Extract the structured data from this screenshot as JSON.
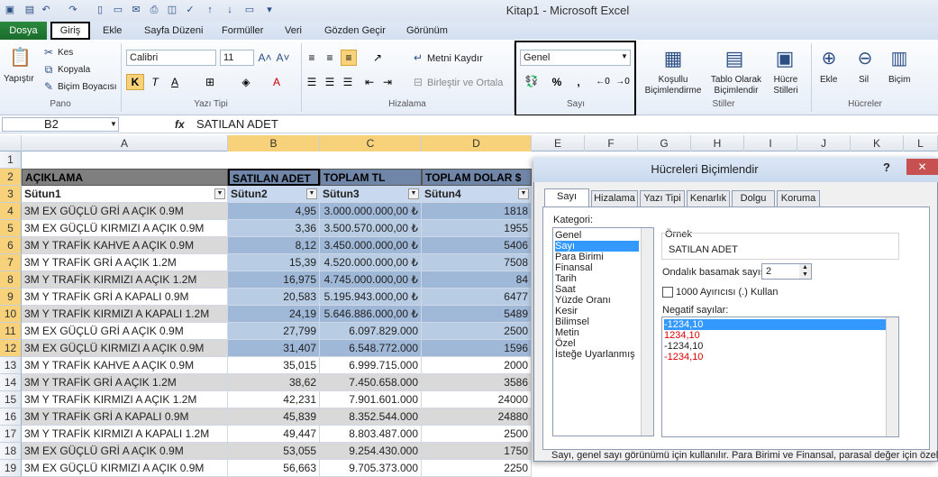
{
  "window": {
    "title": "Kitap1  -  Microsoft Excel"
  },
  "ribbon_tabs": [
    "Dosya",
    "Giriş",
    "Ekle",
    "Sayfa Düzeni",
    "Formüller",
    "Veri",
    "Gözden Geçir",
    "Görünüm"
  ],
  "clipboard": {
    "paste": "Yapıştır",
    "cut": "Kes",
    "copy": "Kopyala",
    "format_painter": "Biçim Boyacısı",
    "group": "Pano"
  },
  "font": {
    "name": "Calibri",
    "size": "11",
    "group": "Yazı Tipi",
    "bold": "K",
    "italic": "T",
    "underline": "A"
  },
  "alignment": {
    "wrap": "Metni Kaydır",
    "merge": "Birleştir ve Ortala",
    "group": "Hizalama"
  },
  "number": {
    "format": "Genel",
    "percent": "%",
    "comma": ",",
    "group": "Sayı"
  },
  "styles": {
    "conditional": "Koşullu Biçimlendirme",
    "table": "Tablo Olarak Biçimlendir",
    "cell": "Hücre Stilleri",
    "group": "Stiller"
  },
  "cells": {
    "insert": "Ekle",
    "delete": "Sil",
    "format": "Biçim",
    "group": "Hücreler"
  },
  "formula_bar": {
    "name_box": "B2",
    "fx": "fx",
    "content": "SATILAN ADET"
  },
  "columns": [
    "A",
    "B",
    "C",
    "D",
    "E",
    "F",
    "G",
    "H",
    "I",
    "J",
    "K",
    "L"
  ],
  "rows": [
    "1",
    "2",
    "3",
    "4",
    "5",
    "6",
    "7",
    "8",
    "9",
    "10",
    "11",
    "12",
    "13",
    "14",
    "15",
    "16",
    "17",
    "18",
    "19"
  ],
  "header": [
    "AÇIKLAMA",
    "SATILAN ADET",
    "TOPLAM TL",
    "TOPLAM DOLAR $"
  ],
  "subheader": [
    "Sütun1",
    "Sütun2",
    "Sütun3",
    "Sütun4"
  ],
  "data": [
    [
      "3M EX GÜÇLÜ GRİ A AÇIK 0.9M",
      "4,95",
      "3.000.000.000,00 ₺",
      "1818"
    ],
    [
      "3M EX GÜÇLÜ KIRMIZI A AÇIK 0.9M",
      "3,36",
      "3.500.570.000,00 ₺",
      "1955"
    ],
    [
      "3M Y TRAFİK KAHVE A AÇIK 0.9M",
      "8,12",
      "3.450.000.000,00 ₺",
      "5406"
    ],
    [
      "3M Y TRAFİK GRİ A AÇIK 1.2M",
      "15,39",
      "4.520.000.000,00 ₺",
      "7508"
    ],
    [
      "3M Y TRAFİK KIRMIZI A AÇIK 1.2M",
      "16,975",
      "4.745.000.000,00 ₺",
      "84"
    ],
    [
      "3M Y TRAFİK GRİ A KAPALI 0.9M",
      "20,583",
      "5.195.943.000,00 ₺",
      "6477"
    ],
    [
      "3M Y TRAFİK KIRMIZI A KAPALI 1.2M",
      "24,19",
      "5.646.886.000,00 ₺",
      "5489"
    ],
    [
      "3M EX GÜÇLÜ GRİ A AÇIK 0.9M",
      "27,799",
      "6.097.829.000",
      "2500"
    ],
    [
      "3M EX GÜÇLÜ KIRMIZI A AÇIK 0.9M",
      "31,407",
      "6.548.772.000",
      "1596"
    ],
    [
      "3M Y TRAFİK KAHVE A AÇIK 0.9M",
      "35,015",
      "6.999.715.000",
      "2000"
    ],
    [
      "3M Y TRAFİK GRİ A AÇIK 1.2M",
      "38,62",
      "7.450.658.000",
      "3586"
    ],
    [
      "3M Y TRAFİK KIRMIZI A AÇIK 1.2M",
      "42,231",
      "7.901.601.000",
      "24000"
    ],
    [
      "3M Y TRAFİK GRİ A KAPALI 0.9M",
      "45,839",
      "8.352.544.000",
      "24880"
    ],
    [
      "3M Y TRAFİK KIRMIZI A KAPALI 1.2M",
      "49,447",
      "8.803.487.000",
      "2500"
    ],
    [
      "3M EX GÜÇLÜ GRİ A AÇIK 0.9M",
      "53,055",
      "9.254.430.000",
      "1750"
    ],
    [
      "3M EX GÜÇLÜ KIRMIZI A AÇIK 0.9M",
      "56,663",
      "9.705.373.000",
      "2250"
    ]
  ],
  "dialog": {
    "title": "Hücreleri Biçimlendir",
    "help": "?",
    "close": "✕",
    "tabs": [
      "Sayı",
      "Hizalama",
      "Yazı Tipi",
      "Kenarlık",
      "Dolgu",
      "Koruma"
    ],
    "category_label": "Kategori:",
    "categories": [
      "Genel",
      "Sayı",
      "Para Birimi",
      "Finansal",
      "Tarih",
      "Saat",
      "Yüzde Oranı",
      "Kesir",
      "Bilimsel",
      "Metin",
      "Özel",
      "İsteğe Uyarlanmış"
    ],
    "sample_label": "Örnek",
    "sample_value": "SATILAN ADET",
    "decimal_label": "Ondalık basamak sayısı:",
    "decimal_value": "2",
    "thousands_label": "1000 Ayırıcısı (.) Kullan",
    "negative_label": "Negatif sayılar:",
    "negatives": [
      "-1234,10",
      "1234,10",
      "-1234,10",
      "-1234,10"
    ],
    "description": "Sayı, genel sayı görünümü için kullanılır. Para Birimi ve Finansal, parasal değer için özelleştirilmiş"
  }
}
